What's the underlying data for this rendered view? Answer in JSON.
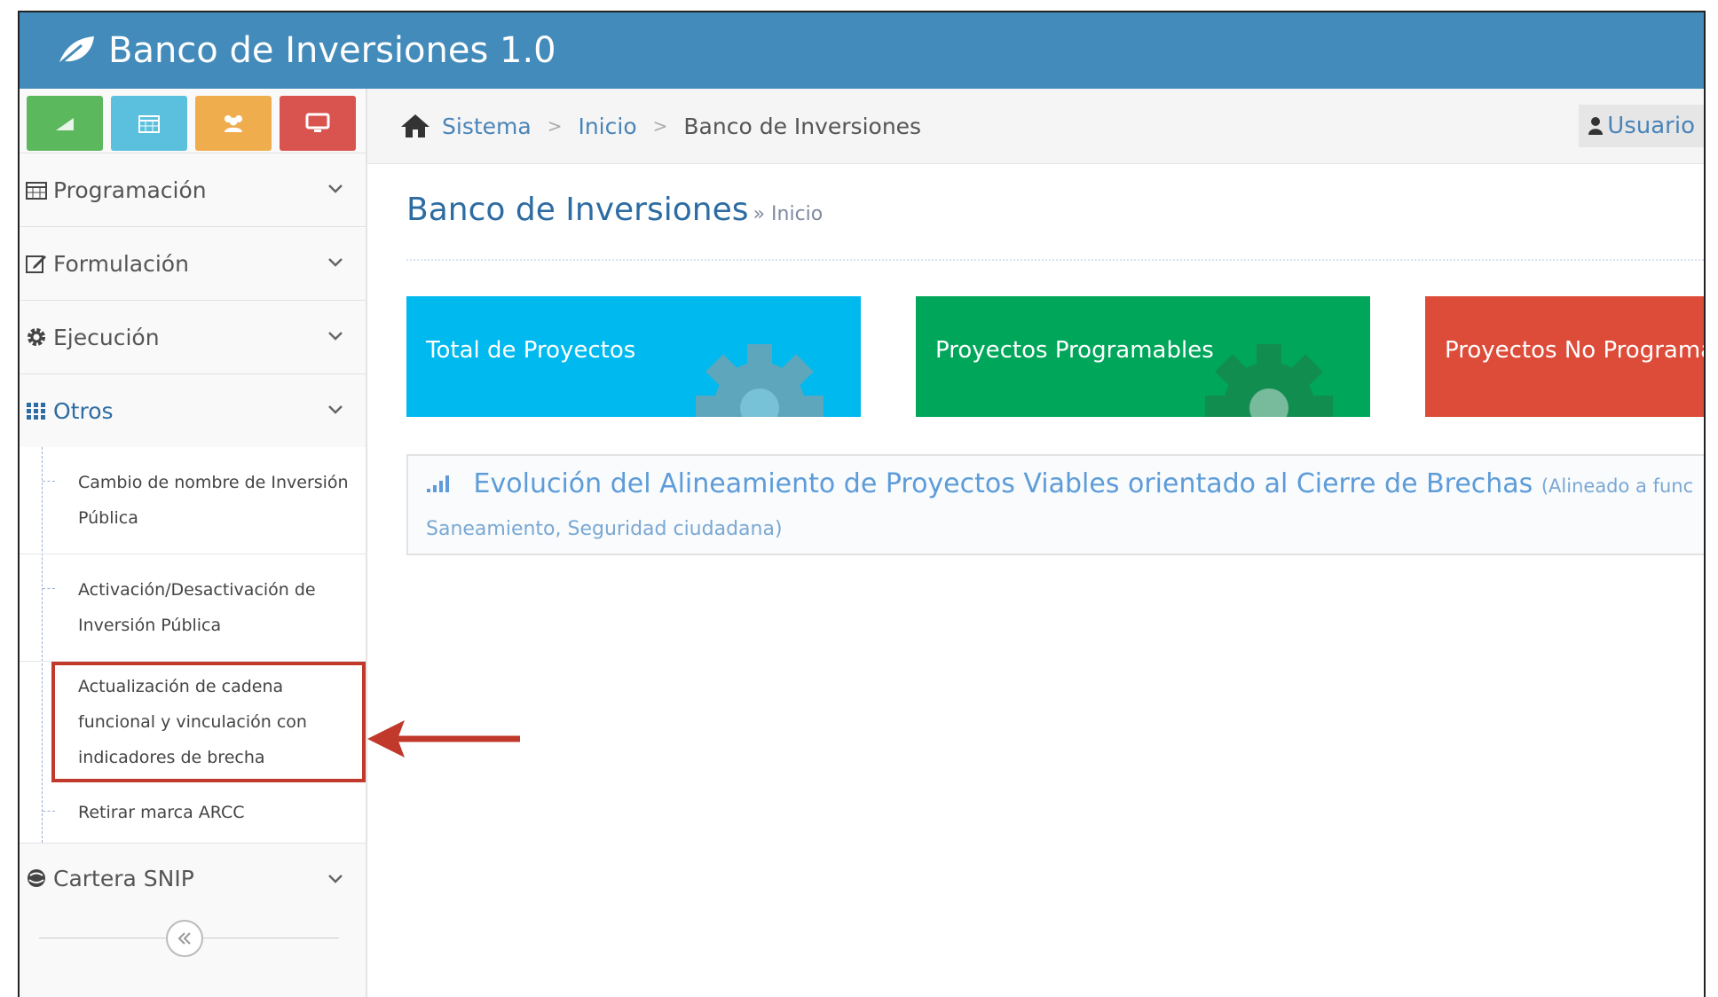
{
  "app": {
    "title": "Banco de Inversiones 1.0"
  },
  "shortcuts": [
    {
      "icon": "signal-icon",
      "color": "#5cb85c"
    },
    {
      "icon": "calendar-icon",
      "color": "#5bc0de"
    },
    {
      "icon": "users-icon",
      "color": "#f0ad4e"
    },
    {
      "icon": "monitor-icon",
      "color": "#d9534f"
    }
  ],
  "sidebar": {
    "menu": [
      {
        "label": "Programación",
        "icon": "calendar-icon"
      },
      {
        "label": "Formulación",
        "icon": "edit-icon"
      },
      {
        "label": "Ejecución",
        "icon": "cog-icon"
      },
      {
        "label": "Otros",
        "icon": "grid-icon"
      }
    ],
    "submenu": [
      {
        "label": "Cambio de nombre de Inversión Pública"
      },
      {
        "label": "Activación/Desactivación de Inversión Pública"
      },
      {
        "label": "Actualización de cadena funcional y vinculación con indicadores de brecha",
        "highlighted": true
      },
      {
        "label": "Retirar marca ARCC"
      }
    ],
    "after": {
      "label": "Cartera SNIP",
      "icon": "globe-icon"
    },
    "collapse_icon": "double-chevron-left-icon"
  },
  "breadcrumbs": {
    "items": [
      "Sistema",
      "Inicio"
    ],
    "current": "Banco de Inversiones",
    "separator": ">"
  },
  "user": {
    "label": "Usuario"
  },
  "page_header": {
    "title": "Banco de Inversiones",
    "subtitle": "» Inicio"
  },
  "stats": [
    {
      "label": "Total de Proyectos",
      "color": "#00b9ee"
    },
    {
      "label": "Proyectos Programables",
      "color": "#00a65a"
    },
    {
      "label": "Proyectos No Programa",
      "color": "#dd4b39"
    }
  ],
  "chart_panel": {
    "title": "Evolución del Alineamiento de Proyectos Viables orientado al Cierre de Brechas",
    "title_small": "(Alineado a func",
    "subtitle": "Saneamiento, Seguridad ciudadana)"
  },
  "annotation": {
    "arrow_color": "#c0392b"
  }
}
